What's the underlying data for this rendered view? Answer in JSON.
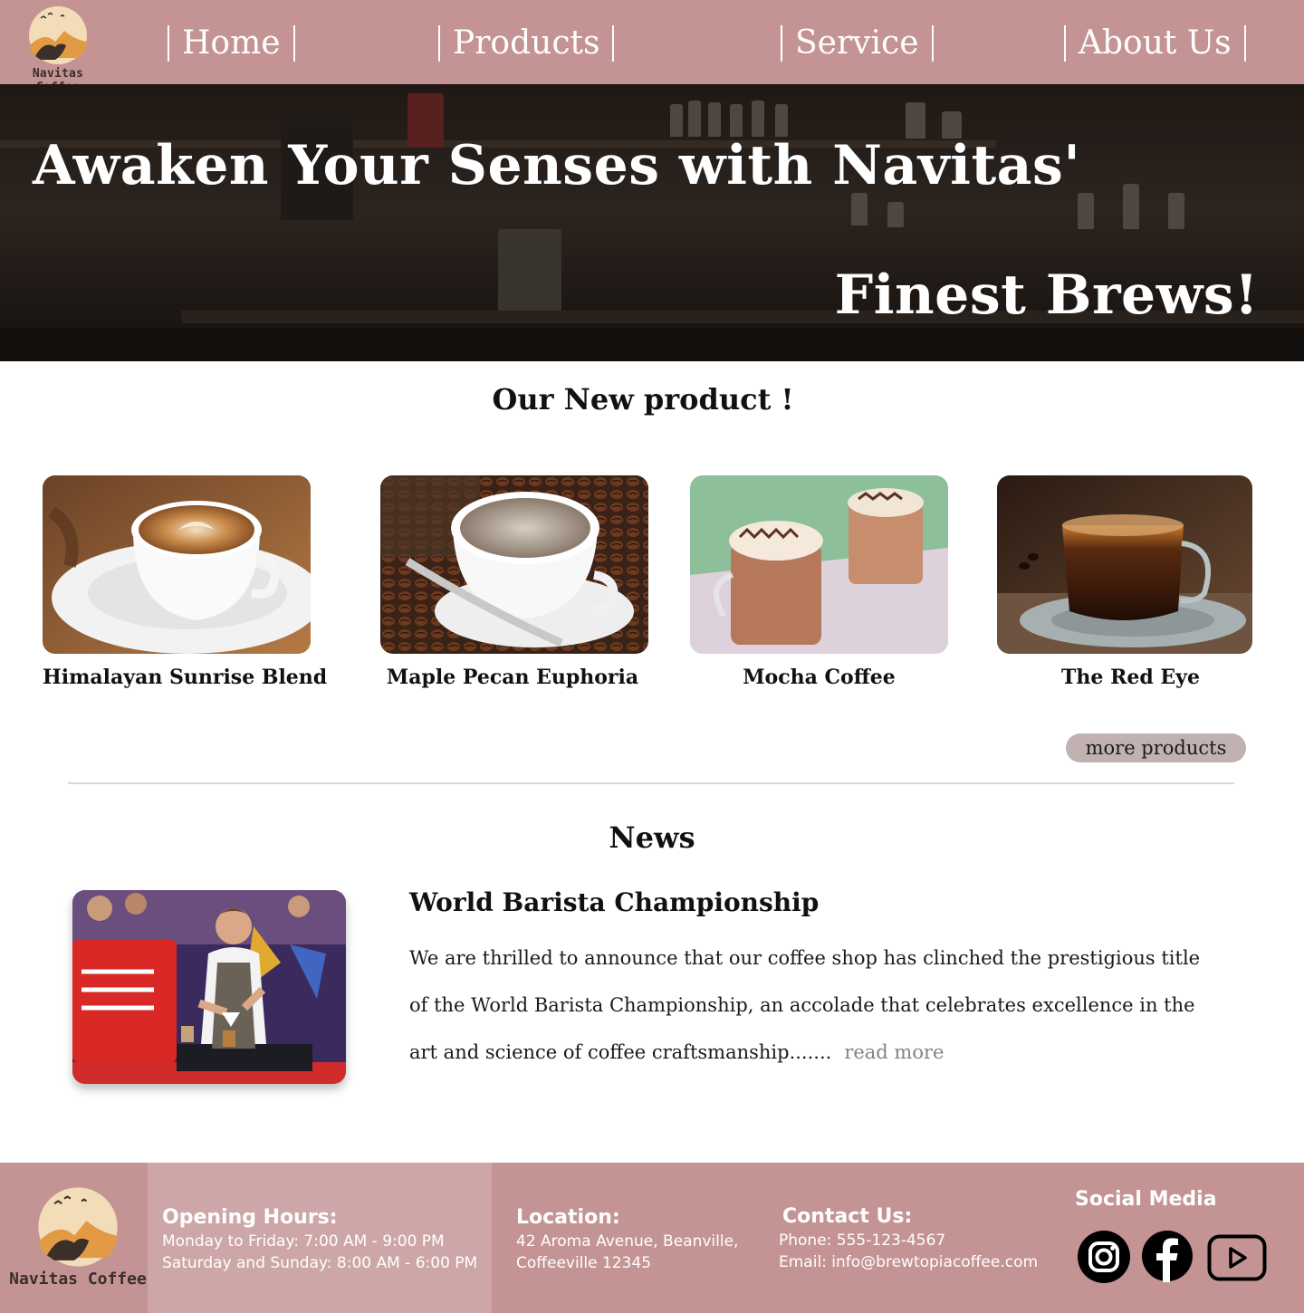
{
  "brand": {
    "name": "Navitas Coffee"
  },
  "nav": {
    "items": [
      {
        "label": "Home"
      },
      {
        "label": "Products"
      },
      {
        "label": "Service"
      },
      {
        "label": "About Us"
      }
    ]
  },
  "hero": {
    "line1": "Awaken Your Senses with Navitas'",
    "line2": "Finest Brews!"
  },
  "products": {
    "title": "Our New product !",
    "items": [
      {
        "name": "Himalayan Sunrise Blend"
      },
      {
        "name": "Maple Pecan Euphoria"
      },
      {
        "name": "Mocha Coffee"
      },
      {
        "name": "The Red Eye"
      }
    ],
    "more_label": "more products"
  },
  "news": {
    "title": "News",
    "headline": "World Barista Championship",
    "body": "We are thrilled to announce that our coffee shop has clinched the prestigious title of the World Barista Championship, an accolade that celebrates excellence in the art and science of coffee craftsmanship.......",
    "read_more": "read more"
  },
  "footer": {
    "hours": {
      "heading": "Opening Hours:",
      "weekday": "Monday to Friday: 7:00 AM - 9:00 PM",
      "weekend": "Saturday and Sunday: 8:00 AM - 6:00 PM"
    },
    "location": {
      "heading": "Location:",
      "line1": "42 Aroma Avenue, Beanville,",
      "line2": "Coffeeville 12345"
    },
    "contact": {
      "heading": "Contact Us:",
      "phone": "Phone: 555-123-4567",
      "email": "Email: info@brewtopiacoffee.com"
    },
    "social": {
      "heading": "Social Media",
      "icons": [
        "instagram-icon",
        "facebook-icon",
        "youtube-icon"
      ]
    }
  },
  "colors": {
    "nav_bg": "#c49494",
    "footer_light": "#cda7a7",
    "button_bg": "#c2b1b1",
    "read_more": "#8c7f7f"
  }
}
